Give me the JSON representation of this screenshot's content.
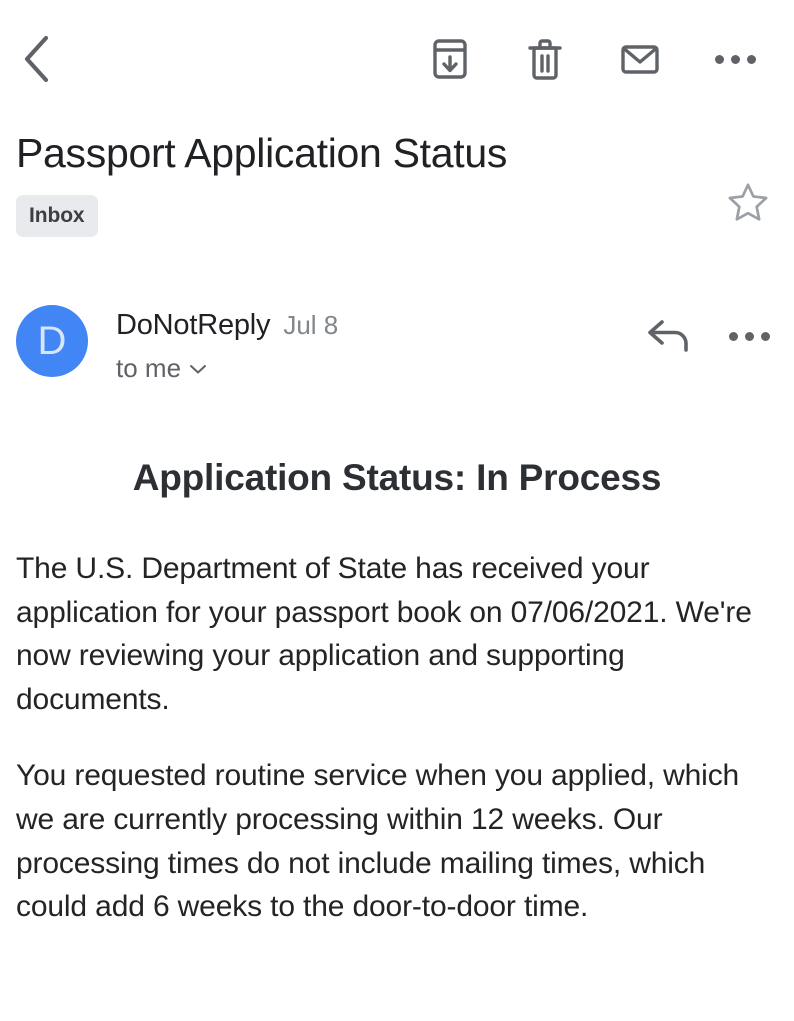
{
  "toolbar": {
    "back": {
      "label": "Back",
      "icon": "chevron-left-icon"
    },
    "actions": [
      {
        "name": "archive",
        "label": "Archive",
        "icon": "archive-icon"
      },
      {
        "name": "delete",
        "label": "Delete",
        "icon": "trash-icon"
      },
      {
        "name": "mark-unread",
        "label": "Mark as unread",
        "icon": "envelope-icon"
      },
      {
        "name": "more",
        "label": "More options",
        "icon": "more-horizontal-icon"
      }
    ]
  },
  "subject": {
    "title": "Passport Application Status",
    "label_chip": "Inbox",
    "star": {
      "icon": "star-outline-icon",
      "label": "Star",
      "starred": false
    }
  },
  "sender": {
    "avatar_initial": "D",
    "avatar_color": "#4285f4",
    "name": "DoNotReply",
    "date": "Jul 8",
    "recipient": "to me",
    "expand_icon": "chevron-down-icon",
    "actions": [
      {
        "name": "reply",
        "label": "Reply",
        "icon": "reply-arrow-icon"
      },
      {
        "name": "more",
        "label": "More options",
        "icon": "more-horizontal-icon"
      }
    ]
  },
  "message": {
    "heading": "Application Status: In Process",
    "paragraphs": [
      "The U.S. Department of State has received your application for your passport book on 07/06/2021. We're now reviewing your application and supporting documents.",
      "You requested routine service when you applied, which we are currently processing within 12 weeks. Our processing times do not include mailing times, which could add 6 weeks to the door-to-door time."
    ]
  },
  "colors": {
    "accent": "#4285f4",
    "icon": "#5f6368",
    "text_primary": "#202124",
    "text_secondary": "#80868b",
    "chip_bg": "#e8eaed"
  }
}
